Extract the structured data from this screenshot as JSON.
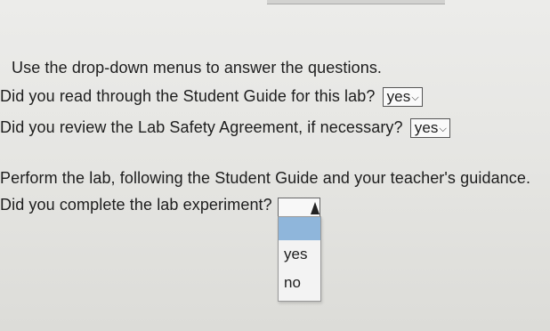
{
  "instructions": "Use the drop-down menus to answer the questions.",
  "questions": [
    {
      "text": "Did you read through the Student Guide for this lab?",
      "answer": "yes"
    },
    {
      "text": "Did you review the Lab Safety Agreement, if necessary?",
      "answer": "yes"
    }
  ],
  "perform_text": "Perform the lab, following the Student Guide and your teacher's guidance.",
  "complete_question": "Did you complete the lab experiment?",
  "dropdown_options": [
    "yes",
    "no"
  ],
  "colors": {
    "highlight": "#8fb6db"
  },
  "icons": {
    "chevron": "chevron-down-icon",
    "cursor": "mouse-cursor-icon"
  }
}
